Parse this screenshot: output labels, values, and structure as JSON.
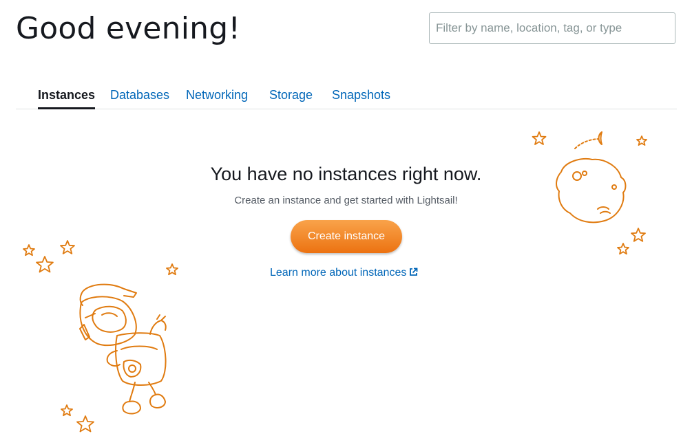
{
  "header": {
    "greeting": "Good evening!"
  },
  "search": {
    "placeholder": "Filter by name, location, tag, or type"
  },
  "tabs": [
    {
      "label": "Instances",
      "active": true
    },
    {
      "label": "Databases",
      "active": false
    },
    {
      "label": "Networking",
      "active": false
    },
    {
      "label": "Storage",
      "active": false
    },
    {
      "label": "Snapshots",
      "active": false
    }
  ],
  "empty_state": {
    "title": "You have no instances right now.",
    "subtitle": "Create an instance and get started with Lightsail!",
    "create_button": "Create instance",
    "learn_link": "Learn more about instances",
    "learn_link_icon": "external-link-icon"
  },
  "illustrations": {
    "robot": "astronaut-robot-illustration",
    "moon": "moon-illustration",
    "stars": "star-icon"
  },
  "colors": {
    "accent": "#ec7211",
    "link": "#0066b8",
    "text": "#16191f",
    "illustration": "#e07b10"
  }
}
